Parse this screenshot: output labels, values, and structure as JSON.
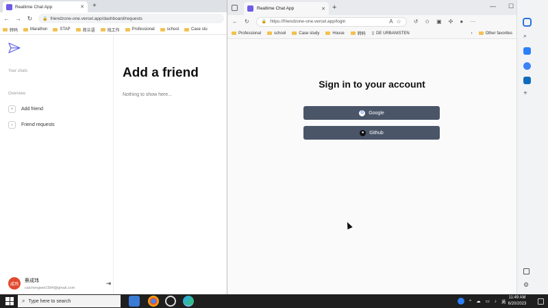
{
  "left_browser": {
    "tab_title": "Realtime Chat App",
    "url": "friendzone-one.vercel.app/dashboard/requests",
    "bookmarks": [
      "转码",
      "Marathon",
      "STAP",
      "荷兰语",
      "找工作",
      "Professional",
      "school",
      "Case stu"
    ]
  },
  "app": {
    "sidebar": {
      "your_chats_label": "Your chats",
      "overview_label": "Overview",
      "items": [
        {
          "label": "Add friend",
          "icon": "user-plus-icon"
        },
        {
          "label": "Friend requests",
          "icon": "user-icon"
        }
      ]
    },
    "user": {
      "avatar_text": "成玮",
      "name": "蔡成玮",
      "email": "caichengwei1994@gmail.com"
    },
    "main": {
      "title": "Add a friend",
      "empty_message": "Nothing to show here..."
    }
  },
  "right_browser": {
    "tab_title": "Realtime Chat App",
    "url": "https://friendzone-one.vercel.app/login",
    "bookmarks": [
      "Professional",
      "school",
      "Case study",
      "House",
      "转码",
      "DE URBANISTEN"
    ],
    "other_favorites": "Other favorites",
    "page": {
      "heading": "Sign in to your account",
      "google_button": "Google",
      "github_button": "Github"
    }
  },
  "taskbar": {
    "search_placeholder": "Type here to search",
    "ime_label": "英",
    "time": "11:49 AM",
    "date": "6/20/2023"
  },
  "colors": {
    "auth_button": "#4a5568",
    "avatar": "#e2492f",
    "favicon": "#6d5ce7"
  }
}
